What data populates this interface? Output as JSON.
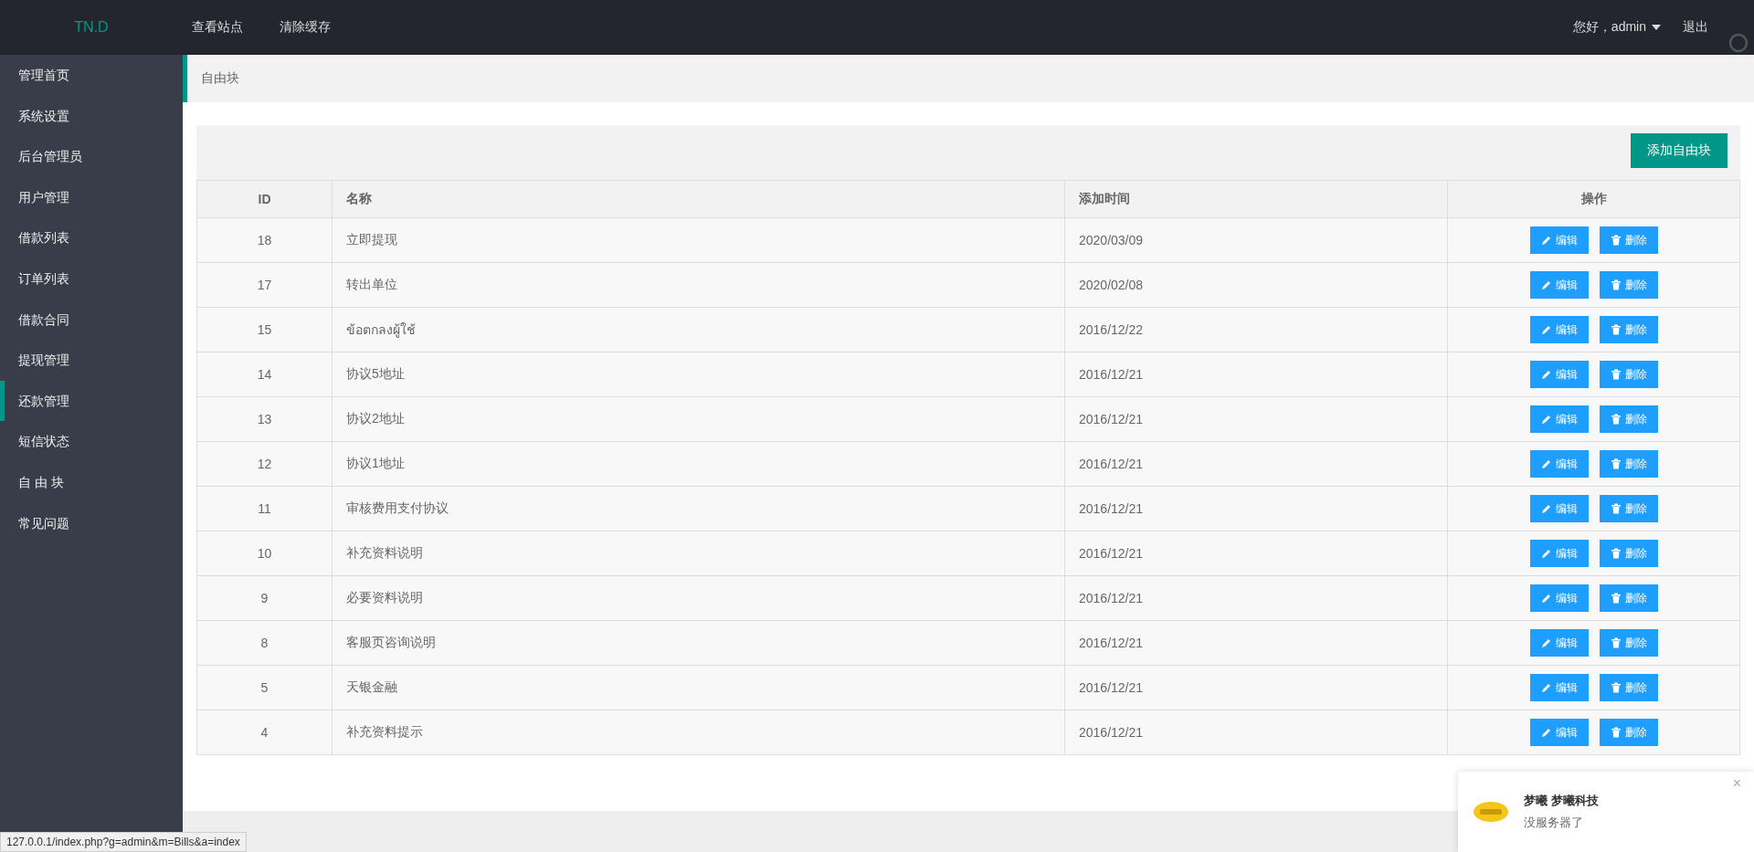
{
  "topbar": {
    "logo": "TN.D",
    "links": [
      "查看站点",
      "清除缓存"
    ],
    "user": "您好，admin",
    "logout": "退出"
  },
  "sidebar": {
    "items": [
      {
        "label": "管理首页",
        "selected": false
      },
      {
        "label": "系统设置",
        "selected": false
      },
      {
        "label": "后台管理员",
        "selected": false
      },
      {
        "label": "用户管理",
        "selected": false
      },
      {
        "label": "借款列表",
        "selected": false
      },
      {
        "label": "订单列表",
        "selected": false
      },
      {
        "label": "借款合同",
        "selected": false
      },
      {
        "label": "提现管理",
        "selected": false
      },
      {
        "label": "还款管理",
        "selected": true
      },
      {
        "label": "短信状态",
        "selected": false
      },
      {
        "label": "自 由 块",
        "selected": false
      },
      {
        "label": "常见问题",
        "selected": false
      }
    ]
  },
  "breadcrumb": "自由块",
  "add_button": "添加自由块",
  "table": {
    "columns": [
      "ID",
      "名称",
      "添加时间",
      "操作"
    ],
    "rows": [
      {
        "id": "18",
        "name": "立即提现",
        "date": "2020/03/09",
        "actions": [
          "编辑",
          "删除"
        ]
      },
      {
        "id": "17",
        "name": "转出单位",
        "date": "2020/02/08",
        "actions": [
          "编辑",
          "删除"
        ]
      },
      {
        "id": "15",
        "name": "ข้อตกลงผู้ใช้",
        "date": "2016/12/22",
        "actions": [
          "编辑",
          "删除"
        ]
      },
      {
        "id": "14",
        "name": "协议5地址",
        "date": "2016/12/21",
        "actions": [
          "编辑",
          "删除"
        ]
      },
      {
        "id": "13",
        "name": "协议2地址",
        "date": "2016/12/21",
        "actions": [
          "编辑",
          "删除"
        ]
      },
      {
        "id": "12",
        "name": "协议1地址",
        "date": "2016/12/21",
        "actions": [
          "编辑",
          "删除"
        ]
      },
      {
        "id": "11",
        "name": "审核费用支付协议",
        "date": "2016/12/21",
        "actions": [
          "编辑",
          "删除"
        ]
      },
      {
        "id": "10",
        "name": "补充资料说明",
        "date": "2016/12/21",
        "actions": [
          "编辑",
          "删除"
        ]
      },
      {
        "id": "9",
        "name": "必要资料说明",
        "date": "2016/12/21",
        "actions": [
          "编辑",
          "删除"
        ]
      },
      {
        "id": "8",
        "name": "客服页咨询说明",
        "date": "2016/12/21",
        "actions": [
          "编辑",
          "删除"
        ]
      },
      {
        "id": "5",
        "name": "天银金融",
        "date": "2016/12/21",
        "actions": [
          "编辑",
          "删除"
        ]
      },
      {
        "id": "4",
        "name": "补充资料提示",
        "date": "2016/12/21",
        "actions": [
          "编辑",
          "删除"
        ]
      }
    ]
  },
  "notification": {
    "title": "梦曦 梦曦科技",
    "message": "没服务器了",
    "close": "×"
  },
  "status_bar": "127.0.0.1/index.php?g=admin&m=Bills&a=index"
}
